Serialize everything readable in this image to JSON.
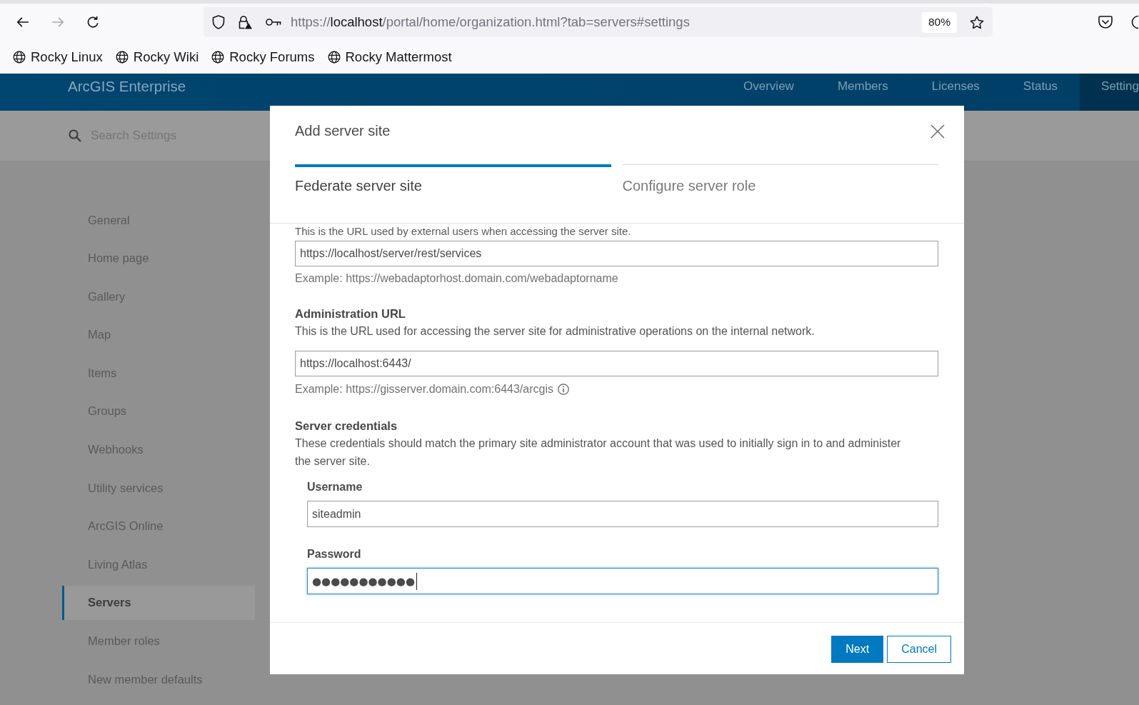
{
  "browser": {
    "nav_buttons": [
      {
        "kind": "back",
        "disabled": false
      },
      {
        "kind": "forward",
        "disabled": true
      },
      {
        "kind": "reload",
        "disabled": false
      }
    ],
    "address_bar": {
      "url_prefix": "https://",
      "url_host": "localhost",
      "url_path": "/portal/home/organization.html?tab=servers#settings",
      "zoom": "80%"
    },
    "bookmarks": [
      {
        "label": "Rocky Linux"
      },
      {
        "label": "Rocky Wiki"
      },
      {
        "label": "Rocky Forums"
      },
      {
        "label": "Rocky Mattermost"
      }
    ]
  },
  "app_header": {
    "title": "ArcGIS Enterprise",
    "tabs": [
      {
        "label": "Overview",
        "selected": false
      },
      {
        "label": "Members",
        "selected": false
      },
      {
        "label": "Licenses",
        "selected": false
      },
      {
        "label": "Status",
        "selected": false
      },
      {
        "label": "Setting",
        "selected": true
      }
    ]
  },
  "settings_search": {
    "placeholder": "Search Settings"
  },
  "settings_nav": {
    "items": [
      {
        "label": "General",
        "selected": false
      },
      {
        "label": "Home page",
        "selected": false
      },
      {
        "label": "Gallery",
        "selected": false
      },
      {
        "label": "Map",
        "selected": false
      },
      {
        "label": "Items",
        "selected": false
      },
      {
        "label": "Groups",
        "selected": false
      },
      {
        "label": "Webhooks",
        "selected": false
      },
      {
        "label": "Utility services",
        "selected": false
      },
      {
        "label": "ArcGIS Online",
        "selected": false
      },
      {
        "label": "Living Atlas",
        "selected": false
      },
      {
        "label": "Servers",
        "selected": true
      },
      {
        "label": "Member roles",
        "selected": false
      },
      {
        "label": "New member defaults",
        "selected": false
      }
    ]
  },
  "dialog": {
    "title": "Add server site",
    "steps": [
      {
        "label": "Federate server site",
        "selected": true
      },
      {
        "label": "Configure server role",
        "selected": false
      }
    ],
    "services_url": {
      "description": "This is the URL used by external users when accessing the server site.",
      "value": "https://localhost/server/rest/services",
      "example": "Example: https://webadaptorhost.domain.com/webadaptorname"
    },
    "admin_url": {
      "label": "Administration URL",
      "description": "This is the URL used for accessing the server site for administrative operations on the internal network.",
      "value": "https://localhost:6443/",
      "example": "Example: https://gisserver.domain.com:6443/arcgis"
    },
    "credentials": {
      "label": "Server credentials",
      "description": "These credentials should match the primary site administrator account that was used to initially sign in to and administer the server site.",
      "fields": [
        {
          "label": "Username",
          "kind": "text",
          "value": "siteadmin",
          "focused": false
        },
        {
          "label": "Password",
          "kind": "password",
          "value": "●●●●●●●●●●●",
          "focused": true
        }
      ]
    },
    "buttons": [
      {
        "label": "Next",
        "kind": "primary"
      },
      {
        "label": "Cancel",
        "kind": "secondary"
      }
    ]
  }
}
